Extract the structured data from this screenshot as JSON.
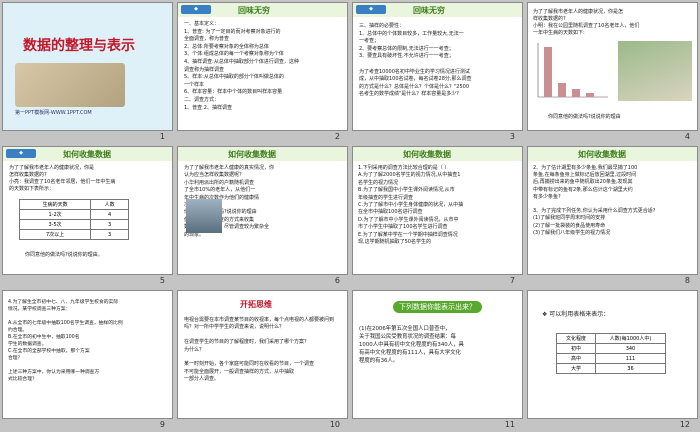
{
  "slides": [
    {
      "n": "1",
      "title": "数据的整理与表示",
      "footer": "第一PPT模板网-WWW.1PPT.COM"
    },
    {
      "n": "2",
      "header": "回味无穷",
      "body": "一、基本定义：\n1、普查: 为了一定目的而对考察对象进行的\n        全面调查，称为普查\n2、总体:所要考察对象的全体称为总体\n3、个体:组成总体的每一个考察对象称为个体\n4、抽样调查:从总体中抽取部分个体进行调查，这种\n        调查称为抽样调查\n5、样本:从总体中抽取的部分个体叫做总体的\n        一个样本\n6、样本容量：样本中个体的数目叫样本容量\n二、调查方式：\n1、普查    2、抽样调查"
    },
    {
      "n": "3",
      "header": "回味无穷",
      "body": "三、抽样的必要性：\n1、总体中的个体数目较多，工作量较大,无法一\n        一考查；\n2、要考察总体的限制,无法进行一一考查；\n3、要查具有破坏性,不允许进行一一考查；\n\n为了考查10000名初中毕业生的学习情况进行测试\n成，从中抽取100名试卷，每名试卷28分,那么调查\n的方式是什么？总体是什么？个体是什么？\"2500\n名考生的数学成绩\"是什么？样本容量是多少?"
    },
    {
      "n": "4",
      "header": "如何收集数据",
      "body": "为了了解我市老年人的健康状况，你是怎\n样收集数据的?\n小明：我在公园里随机调查了10名老年人，他们\n一年中生病的天数如下:",
      "footer": "你同意他的做法吗?说说你的理由"
    },
    {
      "n": "5",
      "header": "如何收集数据",
      "body": "为了了解我市老年人的健康状况，你是\n怎样收集数据的?\n小亮：我调查了10名老年邻居，他们一年中生病\n的天数如下表所示：",
      "footer": "你同意他的做法吗?说说你的理由。",
      "table": [
        [
          "生病的天数",
          "人数"
        ],
        [
          "1-2次",
          "4"
        ],
        [
          "3-5次",
          "3"
        ],
        [
          "7次以上",
          "3"
        ]
      ]
    },
    {
      "n": "6",
      "header": "如何收集数据",
      "body": "为了了解我市老年人健康的真实情况，你\n认为应当怎样收集数据呢？\n    小华利用派出所的户籍随机调查\n了全市10%的老年人，从他们一\n年中生病的次数作为他们的健康情\n况.\n你同意他的做法吗?说说你的理由\n    像小华的随机调查的方式来收集\n数据常用的方法，尽管调查较为繁杂全\n的现象。"
    },
    {
      "n": "7",
      "header": "如何收集数据",
      "body": "1.下列采用的调查方法比较合理的是（     ）\nA.为了了解2000名学生的视力情况,从中抽查1\n名学生的视力情况\nB.为了了解我国中小学生课外阅读情况,从市\n年级抽查的学生进行调查\nC.为了了解市中小学生身体健康的状况，从中抽\n在全市中抽取100名进行调查\nD.为了了解市中小学生课外阅读情况，从市中\n市了小学生中抽取了100名学生进行调查\nE.为了了解某中学在一个学期中抽样调查情况\n现,这学期随机抽取了50名学生的"
    },
    {
      "n": "8",
      "header": "如何收集数据",
      "body": "2、为了估计湖里有多少条鱼,我们最早捕了100\n条鱼,在每条鱼身上做标记后放回湖里,过段时间\n后,再捕捞出来的鱼中随机取出20条鱼,发现其\n中带有标记的鱼有2条,那么估计这个湖里大约\n有多少条鱼?\n\n3、为了完成下列任务,你认为采用什么调查方式更合适?\n(1)了解我班同学周末时间的安排\n(2)了解一批袋装的食品使用寿命\n(3)了解我们八年级学生的视力情况"
    },
    {
      "n": "9",
      "header": "",
      "body": "4.为了解生全市初中七、八、九年级学生校食的实际\n情况，某学校调查三种方案：\n\nA.从全市的七年级中抽取100名学生调查，抽样的比例\n约合理。\nB.在全市的初中生中，抽取100名\n学生的数据调查。\nC.在全市的全部学校中抽取，那个方案\n合理？\n\n上述三种方案中，你认为采用哪一种调查方\n式比较合理？"
    },
    {
      "n": "10",
      "header": "开拓思维",
      "body": "    电视台需要在本市调查某节目的收视率，每个点电视的人都要被问到\n吗？对一所中学学生的调查来说，说明什么？\n\n    在调查学生的节目的了解程度时，我们采用了哪个方案？\n为什么？\n\n    某一时刻开始，各个家庭可能同时在收看的节目，一个调查\n不可能全面展开，一般调查抽样的方式，从中抽取\n一部分人调查。"
    },
    {
      "n": "11",
      "header": "",
      "tag": "下列数据你能表示出来？",
      "body": "(1)在2006年第五次全国人口普查中，\n关于我国公民受教育状况的调查结果：每\n1000人中具有初中文化程度的有340人，具\n有高中文化程度的有111人，具有大学文化\n程度的有36人。"
    },
    {
      "n": "12",
      "header": "",
      "body": "❖ 可以利用表格来表示：",
      "table": [
        [
          "文化程度",
          "人数(每1000人中)"
        ],
        [
          "初中",
          "340"
        ],
        [
          "高中",
          "111"
        ],
        [
          "大学",
          "36"
        ]
      ]
    }
  ],
  "colors": {
    "accent": "#7bc24a",
    "title_red": "#c0182a",
    "cover": "#d9eef7"
  }
}
